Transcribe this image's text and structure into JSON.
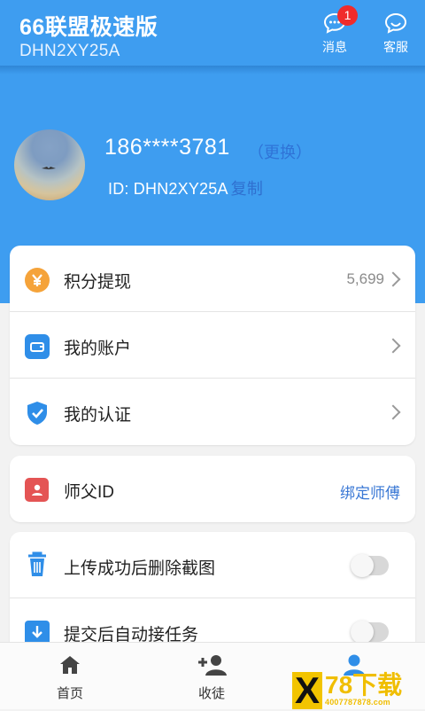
{
  "app": {
    "title": "66联盟极速版",
    "subtitle": "DHN2XY25A"
  },
  "header_actions": {
    "messages": {
      "label": "消息",
      "badge": "1",
      "icon": "chat-bubble-icon"
    },
    "service": {
      "label": "客服",
      "icon": "customer-service-icon"
    }
  },
  "profile": {
    "phone": "186****3781",
    "change_label": "（更换）",
    "id_text": "ID: DHN2XY25A",
    "copy_label": "复制",
    "avatar": "avatar-image"
  },
  "menu_group_1": [
    {
      "label": "积分提现",
      "value": "5,699",
      "icon": "yuan-icon",
      "color": "#f5a33a"
    },
    {
      "label": "我的账户",
      "icon": "wallet-icon",
      "color": "#2f8ee8"
    },
    {
      "label": "我的认证",
      "icon": "shield-check-icon",
      "color": "#2f8ee8"
    }
  ],
  "menu_group_2": [
    {
      "label": "师父ID",
      "action": "绑定师傅",
      "icon": "contact-card-icon",
      "color": "#e45454"
    }
  ],
  "settings": [
    {
      "label": "上传成功后删除截图",
      "icon": "trash-icon",
      "enabled": false
    },
    {
      "label": "提交后自动接任务",
      "icon": "download-card-icon",
      "enabled": false
    }
  ],
  "bottom_nav": [
    {
      "label": "首页",
      "icon": "home-icon"
    },
    {
      "label": "收徒",
      "icon": "add-person-icon"
    },
    {
      "label": "",
      "icon": "person-icon",
      "active": true
    }
  ],
  "watermark": {
    "mark": "X",
    "title": "78下载",
    "subtitle": "4007787878.com"
  },
  "colors": {
    "primary": "#3e9df0",
    "link": "#3a78d5",
    "badge": "#f02b2b"
  }
}
